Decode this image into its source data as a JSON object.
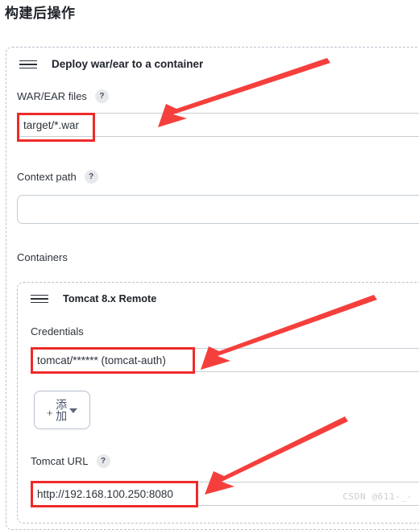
{
  "page": {
    "title": "构建后操作",
    "watermark": "CSDN @611-_-"
  },
  "colors": {
    "highlight": "#ee2b29",
    "arrow": "#f53f3c",
    "border_dashed": "#b9c2cc",
    "input_border": "#c7ced4",
    "text": "#2d333b"
  },
  "outer_panel": {
    "header": {
      "drag_handle_icon": "drag-handle-icon",
      "title": "Deploy war/ear to a container"
    },
    "fields": [
      {
        "label": "WAR/EAR files",
        "help_icon": "help-icon",
        "help_text": "?",
        "value": "target/*.war",
        "highlighted": true
      },
      {
        "label": "Context path",
        "help_icon": "help-icon",
        "help_text": "?",
        "value": "",
        "highlighted": false
      }
    ],
    "containers_label": "Containers"
  },
  "inner_panel": {
    "header": {
      "drag_handle_icon": "drag-handle-icon",
      "title": "Tomcat 8.x Remote"
    },
    "credentials": {
      "label": "Credentials",
      "value": "tomcat/****** (tomcat-auth)",
      "highlighted": true
    },
    "add_button": {
      "plus_icon": "plus-icon",
      "label": "添加",
      "caret_icon": "chevron-down-icon"
    },
    "tomcat_url": {
      "label": "Tomcat URL",
      "help_icon": "help-icon",
      "help_text": "?",
      "value": "http://192.168.100.250:8080",
      "highlighted": true
    }
  },
  "annotations": {
    "arrows": [
      {
        "name": "arrow-to-war-ear-files"
      },
      {
        "name": "arrow-to-credentials"
      },
      {
        "name": "arrow-to-tomcat-url"
      }
    ]
  }
}
